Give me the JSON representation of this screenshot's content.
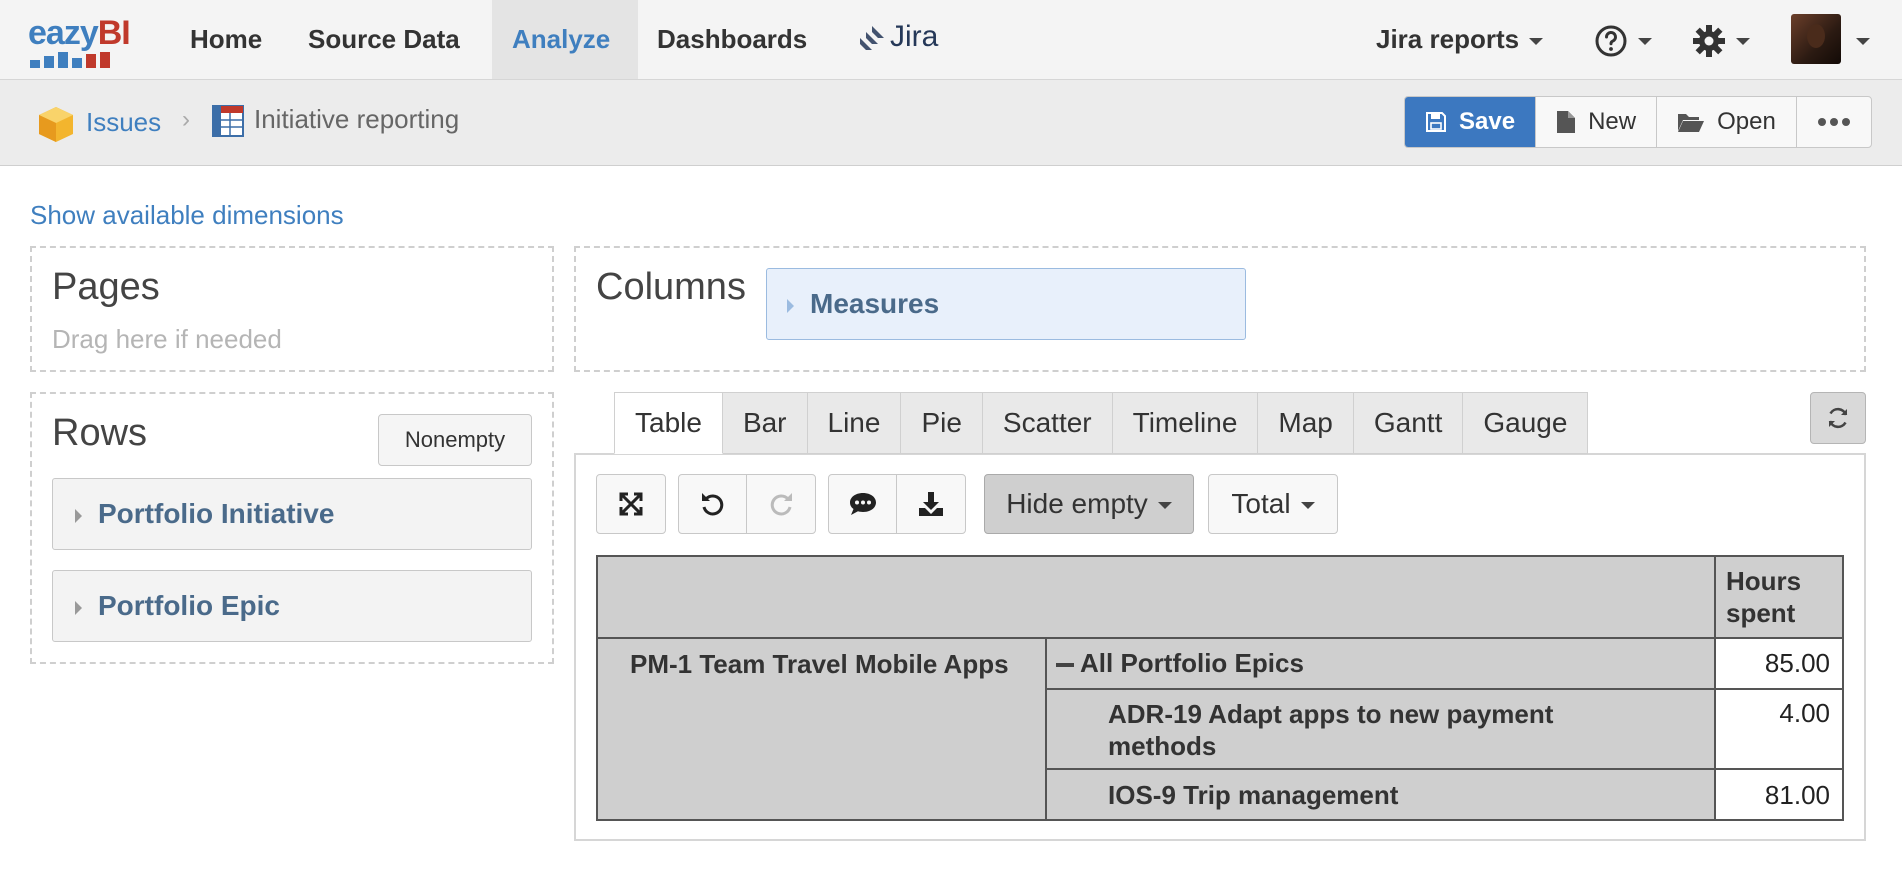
{
  "nav": {
    "logo_prefix": "ea",
    "logo_z": "zy",
    "logo_suffix": "BI",
    "home": "Home",
    "source_data": "Source Data",
    "analyze": "Analyze",
    "dashboards": "Dashboards",
    "jira": "Jira",
    "jira_reports": "Jira reports",
    "help_icon": "question-circle-icon",
    "settings_icon": "gear-icon"
  },
  "breadcrumb": {
    "cube": "Issues",
    "report": "Initiative reporting"
  },
  "toolbar": {
    "save": "Save",
    "new": "New",
    "open": "Open"
  },
  "show_dimensions": "Show available dimensions",
  "pages": {
    "title": "Pages",
    "hint": "Drag here if needed"
  },
  "columns": {
    "title": "Columns",
    "items": [
      "Measures"
    ]
  },
  "rows": {
    "title": "Rows",
    "nonempty": "Nonempty",
    "items": [
      "Portfolio Initiative",
      "Portfolio Epic"
    ]
  },
  "tabs": [
    "Table",
    "Bar",
    "Line",
    "Pie",
    "Scatter",
    "Timeline",
    "Map",
    "Gantt",
    "Gauge"
  ],
  "active_tab": "Table",
  "table_tools": {
    "hide_empty": "Hide empty",
    "total": "Total"
  },
  "result": {
    "column_header": "Hours spent",
    "initiative": "PM-1 Team Travel Mobile Apps",
    "rows": [
      {
        "label": "All Portfolio Epics",
        "value": "85.00",
        "expanded": true
      },
      {
        "label": "ADR-19 Adapt apps to new payment methods",
        "value": "4.00"
      },
      {
        "label": "IOS-9 Trip management",
        "value": "81.00"
      }
    ]
  },
  "colors": {
    "accent": "#3f7fbf",
    "primary_button": "#3c78c0",
    "logo_red": "#c0392b"
  }
}
